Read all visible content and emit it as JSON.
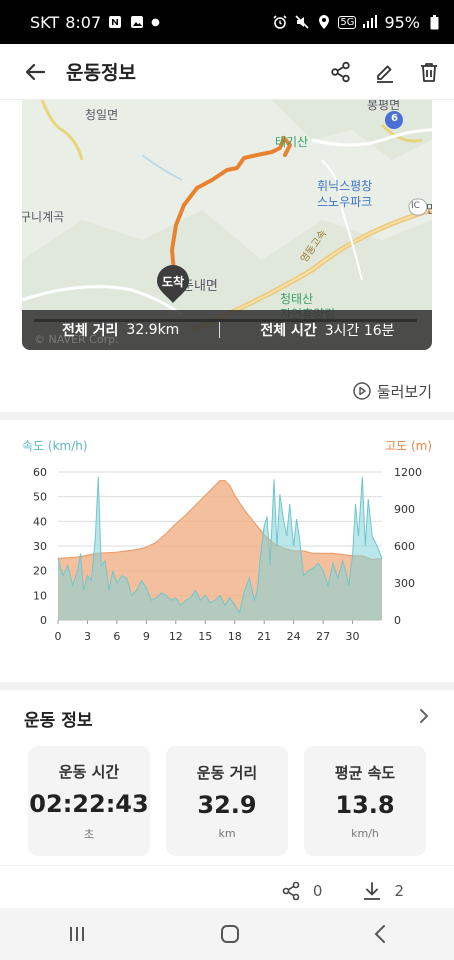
{
  "status": {
    "carrier": "SKT",
    "time": "8:07",
    "network": "5G",
    "battery": "95%"
  },
  "header": {
    "title": "운동정보",
    "icons": [
      "back-arrow-icon",
      "share-icon",
      "edit-icon",
      "trash-icon"
    ]
  },
  "map": {
    "labels": {
      "cheongil": "청일면",
      "dunnae": "둔내면",
      "bongpyeong": "봉평면",
      "taegisan": "태기산",
      "phoenix1": "휘닉스평창",
      "phoenix2": "스노우파크",
      "cheongtaesan1": "청태산",
      "cheongtaesan2": "자연휴양림",
      "highway": "영동고속",
      "kunigye": "구니계곡",
      "route_num": "6",
      "ic": "IC",
      "myeon": "면"
    },
    "arrival_pin": "도착",
    "watermark": "© NAVER Corp.",
    "total_distance_label": "전체 거리",
    "total_distance_value": "32.9km",
    "total_time_label": "전체 시간",
    "total_time_value": "3시간 16분"
  },
  "lookaround": {
    "label": "둘러보기"
  },
  "chart_data": {
    "type": "area",
    "left_axis_label": "속도 (km/h)",
    "right_axis_label": "고도 (m)",
    "x_ticks": [
      "0",
      "3",
      "6",
      "9",
      "12",
      "15",
      "18",
      "21",
      "24",
      "27",
      "30"
    ],
    "y_left_ticks": [
      "60",
      "50",
      "40",
      "30",
      "20",
      "10",
      "0"
    ],
    "y_right_ticks": [
      "1200",
      "900",
      "600",
      "300",
      "0"
    ],
    "xlim": [
      0,
      33
    ],
    "y_left_lim": [
      0,
      60
    ],
    "y_right_lim": [
      0,
      1200
    ],
    "grid": true,
    "colors": {
      "speed": "#7fd3d9",
      "altitude": "#f2b48c",
      "left_axis": "#5bb8c4",
      "right_axis": "#e48a4a"
    },
    "altitude": {
      "x": [
        0,
        2,
        4,
        6,
        8,
        9,
        10,
        11,
        12,
        13,
        14,
        15,
        16,
        16.5,
        17,
        17.5,
        18,
        19,
        20,
        21,
        22,
        23,
        24,
        25,
        26,
        28,
        30,
        31,
        32,
        33
      ],
      "y": [
        500,
        510,
        540,
        550,
        570,
        590,
        630,
        700,
        780,
        850,
        930,
        1010,
        1090,
        1130,
        1130,
        1090,
        1010,
        890,
        790,
        690,
        620,
        580,
        560,
        560,
        540,
        540,
        520,
        520,
        490,
        500
      ]
    },
    "speed": {
      "x": [
        0,
        0.5,
        1,
        1.5,
        2,
        2.3,
        2.6,
        3,
        3.4,
        3.8,
        4.1,
        4.4,
        4.8,
        5.2,
        5.6,
        6,
        6.5,
        7,
        7.5,
        8,
        8.5,
        9,
        9.5,
        10,
        10.5,
        11,
        11.5,
        12,
        12.5,
        13,
        13.5,
        14,
        14.5,
        15,
        15.5,
        16,
        16.5,
        17,
        17.5,
        18,
        18.5,
        19,
        19.5,
        20,
        20.3,
        20.6,
        21,
        21.3,
        21.6,
        22,
        22.3,
        22.6,
        23,
        23.3,
        23.6,
        24,
        24.3,
        24.6,
        25,
        25.5,
        26,
        26.5,
        27,
        27.5,
        28,
        28.5,
        29,
        29.3,
        29.6,
        30,
        30.3,
        30.6,
        31,
        31.3,
        31.6,
        32,
        32.5,
        33
      ],
      "y": [
        25,
        18,
        22,
        14,
        20,
        27,
        12,
        18,
        16,
        33,
        58,
        22,
        24,
        12,
        20,
        15,
        18,
        17,
        10,
        12,
        16,
        13,
        8,
        9,
        11,
        10,
        8,
        9,
        6,
        8,
        9,
        12,
        8,
        10,
        7,
        8,
        10,
        6,
        9,
        6,
        3,
        12,
        17,
        8,
        12,
        25,
        38,
        42,
        22,
        57,
        30,
        51,
        40,
        34,
        47,
        30,
        41,
        33,
        18,
        20,
        21,
        23,
        20,
        14,
        23,
        17,
        24,
        20,
        14,
        26,
        47,
        34,
        58,
        30,
        49,
        34,
        30,
        25
      ]
    }
  },
  "summary": {
    "title": "운동 정보",
    "cards": [
      {
        "label": "운동 시간",
        "value": "02:22:43",
        "unit": "초"
      },
      {
        "label": "운동 거리",
        "value": "32.9",
        "unit": "km"
      },
      {
        "label": "평균 속도",
        "value": "13.8",
        "unit": "km/h"
      }
    ]
  },
  "footer": {
    "share_count": "0",
    "download_count": "2"
  }
}
